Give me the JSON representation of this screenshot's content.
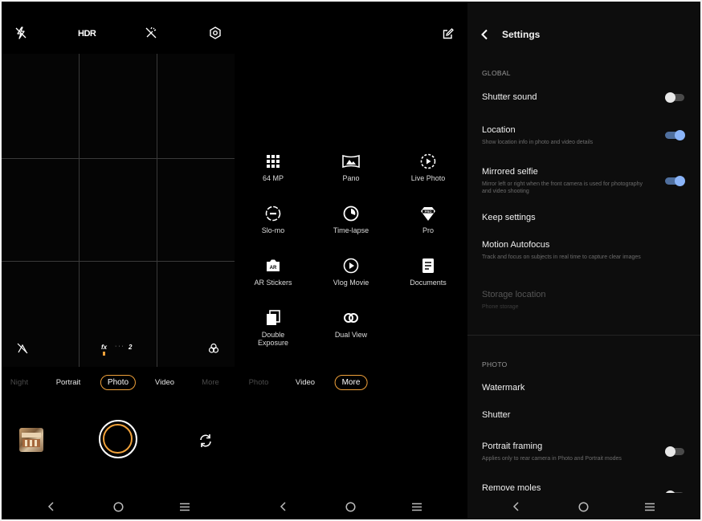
{
  "camera": {
    "top_bar": {
      "hdr_label": "HDR"
    },
    "filter_label": "fx",
    "zoom_label": "2",
    "zoom_dots": "· · ·",
    "modes": [
      {
        "label": "Night",
        "state": "dim"
      },
      {
        "label": "Portrait",
        "state": "normal"
      },
      {
        "label": "Photo",
        "state": "selected"
      },
      {
        "label": "Video",
        "state": "normal"
      },
      {
        "label": "More",
        "state": "dim"
      }
    ]
  },
  "more_menu": {
    "tiles": [
      {
        "label": "64 MP",
        "icon": "grid-64mp-icon"
      },
      {
        "label": "Pano",
        "icon": "panorama-icon"
      },
      {
        "label": "Live Photo",
        "icon": "live-photo-icon"
      },
      {
        "label": "Slo-mo",
        "icon": "slow-motion-icon"
      },
      {
        "label": "Time-lapse",
        "icon": "time-lapse-icon"
      },
      {
        "label": "Pro",
        "icon": "pro-diamond-icon"
      },
      {
        "label": "AR Stickers",
        "icon": "ar-stickers-icon"
      },
      {
        "label": "Vlog Movie",
        "icon": "vlog-play-icon"
      },
      {
        "label": "Documents",
        "icon": "document-icon"
      },
      {
        "label": "Double Exposure",
        "icon": "double-exposure-icon"
      },
      {
        "label": "Dual View",
        "icon": "dual-view-icon"
      }
    ],
    "modes": [
      {
        "label": "Photo",
        "state": "dim"
      },
      {
        "label": "Video",
        "state": "normal"
      },
      {
        "label": "More",
        "state": "selected"
      }
    ]
  },
  "settings": {
    "title": "Settings",
    "global_header": "GLOBAL",
    "photo_header": "PHOTO",
    "items": [
      {
        "title": "Shutter sound",
        "subtitle": "",
        "toggle": "off"
      },
      {
        "title": "Location",
        "subtitle": "Show location info in photo and video details",
        "toggle": "on"
      },
      {
        "title": "Mirrored selfie",
        "subtitle": "Mirror left or right when the front camera is used for photography and video shooting",
        "toggle": "on"
      },
      {
        "title": "Keep settings",
        "subtitle": "",
        "toggle": "none"
      },
      {
        "title": "Motion Autofocus",
        "subtitle": "Track and focus on subjects in real time to capture clear images",
        "toggle": "none"
      },
      {
        "title": "Storage location",
        "subtitle": "Phone storage",
        "toggle": "none",
        "disabled": true
      }
    ],
    "photo_items": [
      {
        "title": "Watermark",
        "subtitle": "",
        "toggle": "none"
      },
      {
        "title": "Shutter",
        "subtitle": "",
        "toggle": "none"
      },
      {
        "title": "Portrait framing",
        "subtitle": "Applies only to rear camera in Photo and Portrait modes",
        "toggle": "off"
      },
      {
        "title": "Remove moles",
        "subtitle": "",
        "toggle": "off"
      }
    ]
  },
  "colors": {
    "accent": "#f0a13a",
    "toggle_on": "#8ab4f8",
    "background": "#000000"
  }
}
